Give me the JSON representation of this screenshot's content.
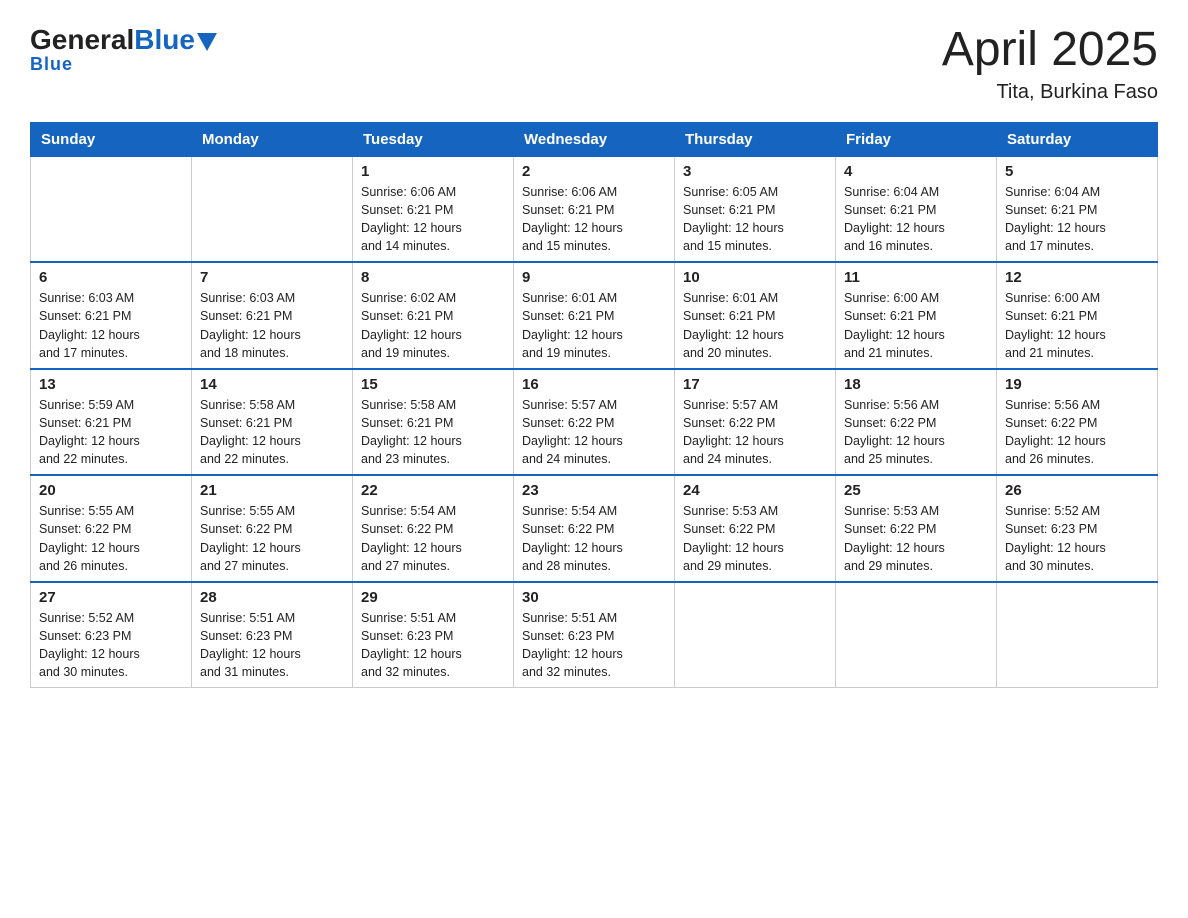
{
  "logo": {
    "general": "General",
    "blue": "Blue"
  },
  "header": {
    "title": "April 2025",
    "subtitle": "Tita, Burkina Faso"
  },
  "weekdays": [
    "Sunday",
    "Monday",
    "Tuesday",
    "Wednesday",
    "Thursday",
    "Friday",
    "Saturday"
  ],
  "weeks": [
    [
      {
        "day": "",
        "info": ""
      },
      {
        "day": "",
        "info": ""
      },
      {
        "day": "1",
        "info": "Sunrise: 6:06 AM\nSunset: 6:21 PM\nDaylight: 12 hours\nand 14 minutes."
      },
      {
        "day": "2",
        "info": "Sunrise: 6:06 AM\nSunset: 6:21 PM\nDaylight: 12 hours\nand 15 minutes."
      },
      {
        "day": "3",
        "info": "Sunrise: 6:05 AM\nSunset: 6:21 PM\nDaylight: 12 hours\nand 15 minutes."
      },
      {
        "day": "4",
        "info": "Sunrise: 6:04 AM\nSunset: 6:21 PM\nDaylight: 12 hours\nand 16 minutes."
      },
      {
        "day": "5",
        "info": "Sunrise: 6:04 AM\nSunset: 6:21 PM\nDaylight: 12 hours\nand 17 minutes."
      }
    ],
    [
      {
        "day": "6",
        "info": "Sunrise: 6:03 AM\nSunset: 6:21 PM\nDaylight: 12 hours\nand 17 minutes."
      },
      {
        "day": "7",
        "info": "Sunrise: 6:03 AM\nSunset: 6:21 PM\nDaylight: 12 hours\nand 18 minutes."
      },
      {
        "day": "8",
        "info": "Sunrise: 6:02 AM\nSunset: 6:21 PM\nDaylight: 12 hours\nand 19 minutes."
      },
      {
        "day": "9",
        "info": "Sunrise: 6:01 AM\nSunset: 6:21 PM\nDaylight: 12 hours\nand 19 minutes."
      },
      {
        "day": "10",
        "info": "Sunrise: 6:01 AM\nSunset: 6:21 PM\nDaylight: 12 hours\nand 20 minutes."
      },
      {
        "day": "11",
        "info": "Sunrise: 6:00 AM\nSunset: 6:21 PM\nDaylight: 12 hours\nand 21 minutes."
      },
      {
        "day": "12",
        "info": "Sunrise: 6:00 AM\nSunset: 6:21 PM\nDaylight: 12 hours\nand 21 minutes."
      }
    ],
    [
      {
        "day": "13",
        "info": "Sunrise: 5:59 AM\nSunset: 6:21 PM\nDaylight: 12 hours\nand 22 minutes."
      },
      {
        "day": "14",
        "info": "Sunrise: 5:58 AM\nSunset: 6:21 PM\nDaylight: 12 hours\nand 22 minutes."
      },
      {
        "day": "15",
        "info": "Sunrise: 5:58 AM\nSunset: 6:21 PM\nDaylight: 12 hours\nand 23 minutes."
      },
      {
        "day": "16",
        "info": "Sunrise: 5:57 AM\nSunset: 6:22 PM\nDaylight: 12 hours\nand 24 minutes."
      },
      {
        "day": "17",
        "info": "Sunrise: 5:57 AM\nSunset: 6:22 PM\nDaylight: 12 hours\nand 24 minutes."
      },
      {
        "day": "18",
        "info": "Sunrise: 5:56 AM\nSunset: 6:22 PM\nDaylight: 12 hours\nand 25 minutes."
      },
      {
        "day": "19",
        "info": "Sunrise: 5:56 AM\nSunset: 6:22 PM\nDaylight: 12 hours\nand 26 minutes."
      }
    ],
    [
      {
        "day": "20",
        "info": "Sunrise: 5:55 AM\nSunset: 6:22 PM\nDaylight: 12 hours\nand 26 minutes."
      },
      {
        "day": "21",
        "info": "Sunrise: 5:55 AM\nSunset: 6:22 PM\nDaylight: 12 hours\nand 27 minutes."
      },
      {
        "day": "22",
        "info": "Sunrise: 5:54 AM\nSunset: 6:22 PM\nDaylight: 12 hours\nand 27 minutes."
      },
      {
        "day": "23",
        "info": "Sunrise: 5:54 AM\nSunset: 6:22 PM\nDaylight: 12 hours\nand 28 minutes."
      },
      {
        "day": "24",
        "info": "Sunrise: 5:53 AM\nSunset: 6:22 PM\nDaylight: 12 hours\nand 29 minutes."
      },
      {
        "day": "25",
        "info": "Sunrise: 5:53 AM\nSunset: 6:22 PM\nDaylight: 12 hours\nand 29 minutes."
      },
      {
        "day": "26",
        "info": "Sunrise: 5:52 AM\nSunset: 6:23 PM\nDaylight: 12 hours\nand 30 minutes."
      }
    ],
    [
      {
        "day": "27",
        "info": "Sunrise: 5:52 AM\nSunset: 6:23 PM\nDaylight: 12 hours\nand 30 minutes."
      },
      {
        "day": "28",
        "info": "Sunrise: 5:51 AM\nSunset: 6:23 PM\nDaylight: 12 hours\nand 31 minutes."
      },
      {
        "day": "29",
        "info": "Sunrise: 5:51 AM\nSunset: 6:23 PM\nDaylight: 12 hours\nand 32 minutes."
      },
      {
        "day": "30",
        "info": "Sunrise: 5:51 AM\nSunset: 6:23 PM\nDaylight: 12 hours\nand 32 minutes."
      },
      {
        "day": "",
        "info": ""
      },
      {
        "day": "",
        "info": ""
      },
      {
        "day": "",
        "info": ""
      }
    ]
  ]
}
